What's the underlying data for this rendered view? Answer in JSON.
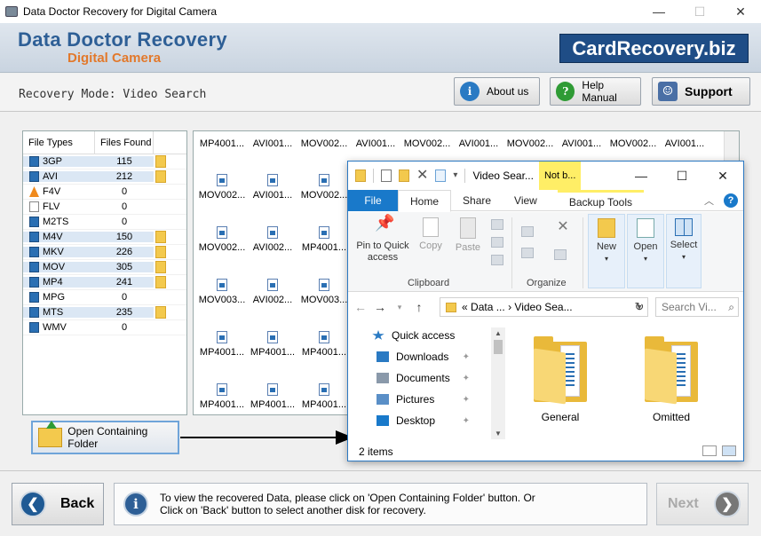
{
  "window": {
    "title": "Data Doctor Recovery for Digital Camera",
    "minimize": "—",
    "maximize": "☐",
    "close": "✕"
  },
  "header": {
    "brand_line1": "Data Doctor Recovery",
    "brand_line2": "Digital Camera",
    "site": "CardRecovery.biz"
  },
  "mode": {
    "text": "Recovery Mode: Video Search"
  },
  "topbuttons": {
    "about": "About us",
    "help": "Help Manual",
    "support": "Support"
  },
  "filetable": {
    "headers": [
      "File Types",
      "Files Found"
    ],
    "rows": [
      {
        "type": "3GP",
        "count": "115",
        "folder": true
      },
      {
        "type": "AVI",
        "count": "212",
        "folder": true
      },
      {
        "type": "F4V",
        "count": "0",
        "folder": false
      },
      {
        "type": "FLV",
        "count": "0",
        "folder": false
      },
      {
        "type": "M2TS",
        "count": "0",
        "folder": false
      },
      {
        "type": "M4V",
        "count": "150",
        "folder": true
      },
      {
        "type": "MKV",
        "count": "226",
        "folder": true
      },
      {
        "type": "MOV",
        "count": "305",
        "folder": true
      },
      {
        "type": "MP4",
        "count": "241",
        "folder": true
      },
      {
        "type": "MPG",
        "count": "0",
        "folder": false
      },
      {
        "type": "MTS",
        "count": "235",
        "folder": true
      },
      {
        "type": "WMV",
        "count": "0",
        "folder": false
      }
    ]
  },
  "thumbs": {
    "row0": [
      "MP4001...",
      "AVI001...",
      "MOV002...",
      "AVI001...",
      "MOV002...",
      "AVI001...",
      "MOV002...",
      "AVI001...",
      "MOV002...",
      "AVI001..."
    ],
    "grid": [
      [
        "MOV002...",
        "AVI001...",
        "MOV002..."
      ],
      [
        "MOV002...",
        "AVI002...",
        "MP4001..."
      ],
      [
        "MOV003...",
        "AVI002...",
        "MOV003..."
      ],
      [
        "MP4001...",
        "MP4001...",
        "MP4001..."
      ],
      [
        "MP4001...",
        "MP4001...",
        "MP4001..."
      ]
    ]
  },
  "open_folder_button": "Open Containing Folder",
  "explorer": {
    "title": "Video Sear...",
    "tools_tab": "Not b...",
    "tabs": {
      "file": "File",
      "home": "Home",
      "share": "Share",
      "view": "View",
      "backup": "Backup Tools"
    },
    "ribbon": {
      "pin_line1": "Pin to Quick",
      "pin_line2": "access",
      "copy": "Copy",
      "paste": "Paste",
      "clipboard": "Clipboard",
      "organize": "Organize",
      "new": "New",
      "open": "Open",
      "select": "Select"
    },
    "address": {
      "prefix": "«",
      "seg1": "Data ...",
      "sep": "›",
      "seg2": "Video Sea...",
      "search_placeholder": "Search Vi..."
    },
    "nav": [
      {
        "label": "Quick access",
        "pinned": false
      },
      {
        "label": "Downloads",
        "pinned": true
      },
      {
        "label": "Documents",
        "pinned": true
      },
      {
        "label": "Pictures",
        "pinned": true
      },
      {
        "label": "Desktop",
        "pinned": true
      }
    ],
    "folders": [
      "General",
      "Omitted"
    ],
    "status": "2 items"
  },
  "bottom": {
    "back": "Back",
    "info_line1": "To view the recovered Data, please click on 'Open Containing Folder' button. Or",
    "info_line2": "Click on 'Back' button to select another disk for recovery.",
    "next": "Next"
  }
}
